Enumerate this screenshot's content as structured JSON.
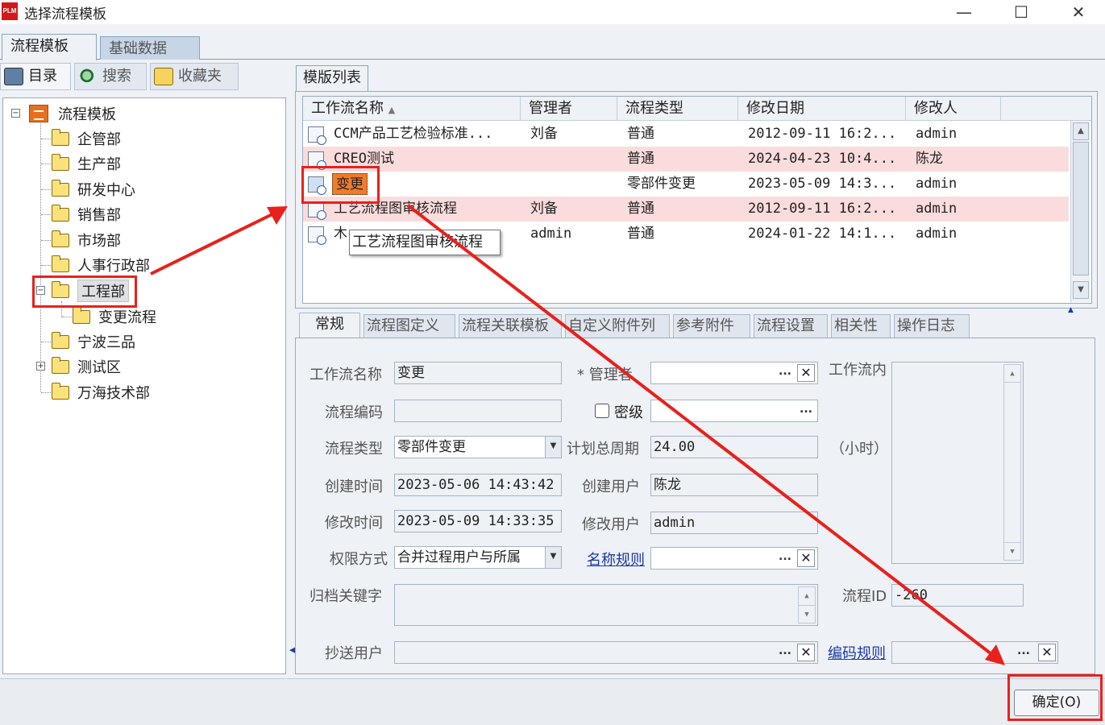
{
  "window": {
    "title": "选择流程模板",
    "logo": "PLM",
    "min": "—",
    "max": "☐",
    "close": "✕"
  },
  "main_tabs": [
    {
      "label": "流程模板"
    },
    {
      "label": "基础数据"
    }
  ],
  "left_tabs": [
    {
      "label": "目录"
    },
    {
      "label": "搜索"
    },
    {
      "label": "收藏夹"
    }
  ],
  "tree": {
    "root": "流程模板",
    "items": [
      "企管部",
      "生产部",
      "研发中心",
      "销售部",
      "市场部",
      "人事行政部",
      "工程部",
      "变更流程",
      "宁波三品",
      "测试区",
      "万海技术部"
    ]
  },
  "list_tab": "模版列表",
  "grid": {
    "headers": [
      "工作流名称",
      "管理者",
      "流程类型",
      "修改日期",
      "修改人"
    ],
    "rows": [
      {
        "name": "CCM产品工艺检验标准...",
        "manager": "刘备",
        "type": "普通",
        "date": "2012-09-11 16:2...",
        "modifier": "admin"
      },
      {
        "name": "CREO测试",
        "manager": "",
        "type": "普通",
        "date": "2024-04-23 10:4...",
        "modifier": "陈龙"
      },
      {
        "name": "变更",
        "manager": "",
        "type": "零部件变更",
        "date": "2023-05-09 14:3...",
        "modifier": "admin"
      },
      {
        "name": "工艺流程图审核流程",
        "manager": "刘备",
        "type": "普通",
        "date": "2012-09-11 16:2...",
        "modifier": "admin"
      },
      {
        "name": "木",
        "manager": "admin",
        "type": "普通",
        "date": "2024-01-22 14:1...",
        "modifier": "admin"
      }
    ],
    "tooltip": "工艺流程图审核流程"
  },
  "sub_tabs": [
    "常规",
    "流程图定义",
    "流程关联模板",
    "自定义附件列",
    "参考附件",
    "流程设置",
    "相关性",
    "操作日志"
  ],
  "form": {
    "name_label": "工作流名称",
    "name_value": "变更",
    "manager_label": "* 管理者",
    "content_label": "工作流内",
    "code_label": "流程编码",
    "code_value": "",
    "secret_label": "密级",
    "type_label": "流程类型",
    "type_value": "零部件变更",
    "cycle_label": "计划总周期",
    "cycle_value": "24.00",
    "cycle_unit": "（小时）",
    "created_label": "创建时间",
    "created_value": "2023-05-06 14:43:42",
    "creator_label": "创建用户",
    "creator_value": "陈龙",
    "modified_label": "修改时间",
    "modified_value": "2023-05-09 14:33:35",
    "modifier_label": "修改用户",
    "modifier_value": "admin",
    "perm_label": "权限方式",
    "perm_value": "合并过程用户与所属",
    "naming_label": "名称规则",
    "keyword_label": "归档关键字",
    "flowid_label": "流程ID",
    "flowid_value": "-260",
    "cc_label": "抄送用户",
    "coding_label": "编码规则",
    "dots": "...",
    "x": "✕"
  },
  "ok_button": "确定(O)",
  "colors": {
    "annotation_red": "#e8211c",
    "highlight_orange": "#f07b2a",
    "pink_row": "#fbdcdc"
  }
}
